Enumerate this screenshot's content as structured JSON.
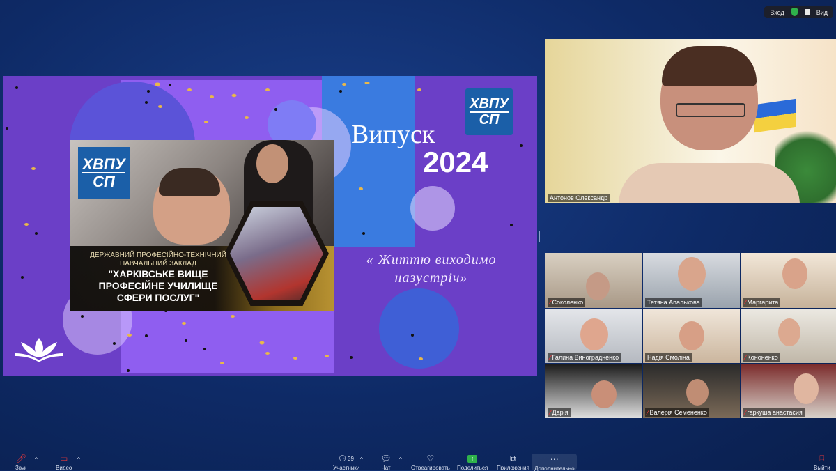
{
  "topbar": {
    "enter_label": "Вход",
    "view_label": "Вид"
  },
  "slide": {
    "logo_text_top": "ХВПУ",
    "logo_text_bottom": "СП",
    "title": "Випуск",
    "year": "2024",
    "slogan_line1": "« Життю виходимо",
    "slogan_line2": "назустріч»",
    "institution_line1": "ДЕРЖАВНИЙ ПРОФЕСІЙНО-ТЕХНІЧНИЙ",
    "institution_line2": "НАВЧАЛЬНИЙ ЗАКЛАД",
    "institution_name_1": "\"ХАРКІВСЬКЕ ВИЩЕ",
    "institution_name_2": "ПРОФЕСІЙНЕ УЧИЛИЩЕ",
    "institution_name_3": "СФЕРИ ПОСЛУГ\""
  },
  "speaker": {
    "name": "Антонов Олександр"
  },
  "participants": [
    {
      "name": "Соколенко",
      "muted": true
    },
    {
      "name": "Тетяна Апалькова",
      "muted": false
    },
    {
      "name": "Маргарита",
      "muted": true
    },
    {
      "name": "Галина Виноградненко",
      "muted": true
    },
    {
      "name": "Надія Смоліна",
      "muted": false
    },
    {
      "name": "Кононенко",
      "muted": true
    },
    {
      "name": "Дарія",
      "muted": true
    },
    {
      "name": "Валерія Семененко",
      "muted": true
    },
    {
      "name": "гаркуша анастасия",
      "muted": true
    }
  ],
  "toolbar": {
    "audio_label": "Звук",
    "video_label": "Видео",
    "participants_label": "Участники",
    "participants_count": "39",
    "chat_label": "Чат",
    "react_label": "Отреагировать",
    "share_label": "Поделиться",
    "apps_label": "Приложения",
    "more_label": "Дополнительно",
    "leave_label": "Выйти"
  },
  "colors": {
    "slide_bg": "#6b3fc7",
    "accent_blue": "#3a7be0",
    "logo_blue": "#1b5fa8",
    "leave_red": "#e5383b"
  }
}
